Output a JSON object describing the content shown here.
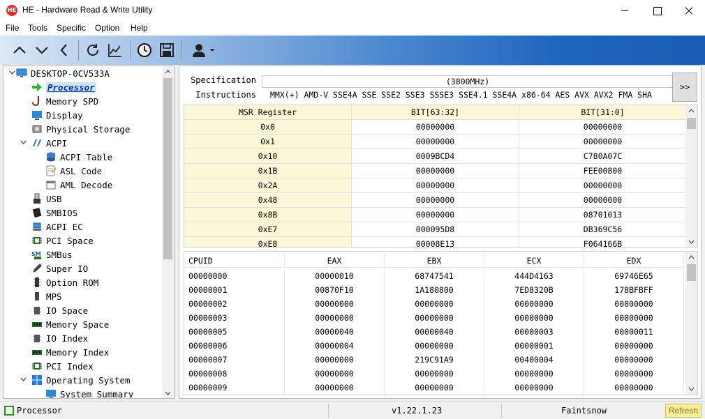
{
  "window": {
    "app_icon_text": "HE",
    "title": "HE - Hardware Read & Write Utility"
  },
  "menu": [
    "File",
    "Tools",
    "Specific",
    "Option",
    "Help"
  ],
  "toolbar": {
    "buttons": [
      "arrow-up-icon",
      "arrow-down-icon",
      "arrow-left-icon",
      "refresh-icon",
      "chart-icon",
      "clock-icon",
      "save-icon",
      "user-icon"
    ]
  },
  "tree": {
    "root": "DESKTOP-0CV533A",
    "items": [
      {
        "label": "Processor",
        "icon": "arrow-right-icon",
        "selected": true
      },
      {
        "label": "Memory SPD",
        "icon": "memory-spd-icon"
      },
      {
        "label": "Display",
        "icon": "monitor-icon"
      },
      {
        "label": "Physical Storage",
        "icon": "disk-icon"
      },
      {
        "label": "ACPI",
        "icon": "acpi-icon",
        "expanded": true
      },
      {
        "label": "ACPI Table",
        "icon": "database-icon",
        "child": true
      },
      {
        "label": "ASL Code",
        "icon": "code-doc-icon",
        "child": true
      },
      {
        "label": "AML Decode",
        "icon": "decode-icon",
        "child": true
      },
      {
        "label": "USB",
        "icon": "usb-icon"
      },
      {
        "label": "SMBIOS",
        "icon": "smbios-icon"
      },
      {
        "label": "ACPI EC",
        "icon": "laptop-icon"
      },
      {
        "label": "PCI Space",
        "icon": "chip-icon"
      },
      {
        "label": "SMBus",
        "icon": "smbus-icon"
      },
      {
        "label": "Super IO",
        "icon": "pen-icon"
      },
      {
        "label": "Option ROM",
        "icon": "rom-icon"
      },
      {
        "label": "MPS",
        "icon": "mps-icon"
      },
      {
        "label": "IO Space",
        "icon": "io-icon"
      },
      {
        "label": "Memory Space",
        "icon": "memory-stick-icon"
      },
      {
        "label": "IO Index",
        "icon": "io-index-icon"
      },
      {
        "label": "Memory Index",
        "icon": "memory-index-icon"
      },
      {
        "label": "PCI Index",
        "icon": "chip-icon"
      },
      {
        "label": "Operating System",
        "icon": "windows-icon",
        "expanded": true
      },
      {
        "label": "System Summary",
        "icon": "monitor-icon",
        "child": true
      }
    ]
  },
  "spec": {
    "spec_label": "Specification",
    "spec_value": "(3800MHz)",
    "instr_label": "Instructions",
    "instr_value": "MMX(+) AMD-V SSE4A SSE SSE2 SSE3 SSSE3 SSE4.1 SSE4A x86-64 AES AVX AVX2 FMA SHA",
    "more_label": ">>"
  },
  "msr": {
    "headers": [
      "MSR Register",
      "BIT[63:32]",
      "BIT[31:0]"
    ],
    "rows": [
      [
        "0x0",
        "00000000",
        "00000000"
      ],
      [
        "0x1",
        "00000000",
        "00000000"
      ],
      [
        "0x10",
        "0009BCD4",
        "C780A07C"
      ],
      [
        "0x1B",
        "00000000",
        "FEE00800"
      ],
      [
        "0x2A",
        "00000000",
        "00000000"
      ],
      [
        "0x48",
        "00000000",
        "00000000"
      ],
      [
        "0x8B",
        "00000000",
        "08701013"
      ],
      [
        "0xE7",
        "000095D8",
        "DB369C56"
      ],
      [
        "0xE8",
        "00008E13",
        "F064166B"
      ]
    ]
  },
  "cpuid": {
    "headers": [
      "CPUID",
      "EAX",
      "EBX",
      "ECX",
      "EDX"
    ],
    "rows": [
      [
        "00000000",
        "00000010",
        "68747541",
        "444D4163",
        "69746E65"
      ],
      [
        "00000001",
        "00870F10",
        "1A180800",
        "7ED8320B",
        "178BFBFF"
      ],
      [
        "00000002",
        "00000000",
        "00000000",
        "00000000",
        "00000000"
      ],
      [
        "00000003",
        "00000000",
        "00000000",
        "00000000",
        "00000000"
      ],
      [
        "00000005",
        "00000040",
        "00000040",
        "00000003",
        "00000011"
      ],
      [
        "00000006",
        "00000004",
        "00000000",
        "00000001",
        "00000000"
      ],
      [
        "00000007",
        "00000000",
        "219C91A9",
        "00400004",
        "00000000"
      ],
      [
        "00000008",
        "00000000",
        "00000000",
        "00000000",
        "00000000"
      ],
      [
        "00000009",
        "00000000",
        "00000000",
        "00000000",
        "00000000"
      ]
    ]
  },
  "status": {
    "left": "Processor",
    "version": "v1.22.1.23",
    "author": "Faintsnow",
    "refresh": "Refresh"
  }
}
